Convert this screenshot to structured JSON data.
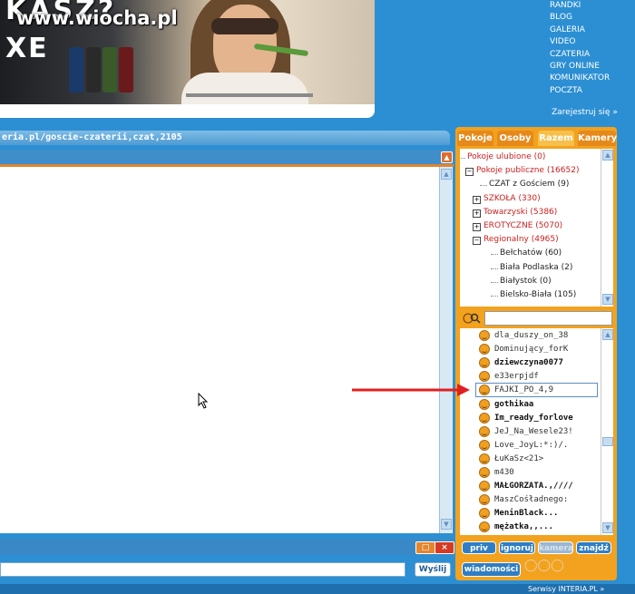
{
  "banner": {
    "headline": "KASZ?",
    "brand": "XE",
    "watermark": "www.wiocha.pl"
  },
  "menu": {
    "items": [
      "RANDKI",
      "BLOG",
      "GALERIA",
      "VIDEO",
      "CZATERIA",
      "GRY ONLINE",
      "KOMUNIKATOR",
      "POCZTA"
    ],
    "register": "Zarejestruj się »"
  },
  "chat": {
    "url": "eria.pl/goscie-czaterii,czat,2105",
    "send_label": "Wyślij",
    "close_glyph": "×",
    "restore_glyph": "□"
  },
  "panel": {
    "tabs": [
      "Pokoje",
      "Osoby",
      "Razem",
      "Kamery"
    ],
    "active_tab": "Razem",
    "tree": [
      {
        "label": "Pokoje ulubione (0)",
        "color": "red",
        "indent": 0,
        "box": ""
      },
      {
        "label": "Pokoje publiczne (16652)",
        "color": "red",
        "indent": 0,
        "box": "−"
      },
      {
        "label": "CZAT z Gościem (9)",
        "color": "black",
        "indent": 2,
        "box": ""
      },
      {
        "label": "SZKOŁA (330)",
        "color": "red",
        "indent": 1,
        "box": "+"
      },
      {
        "label": "Towarzyski (5386)",
        "color": "red",
        "indent": 1,
        "box": "+"
      },
      {
        "label": "EROTYCZNE (5070)",
        "color": "red",
        "indent": 1,
        "box": "+"
      },
      {
        "label": "Regionalny (4965)",
        "color": "red",
        "indent": 1,
        "box": "−"
      },
      {
        "label": "Bełchatów (60)",
        "color": "black",
        "indent": 3,
        "box": ""
      },
      {
        "label": "Biała Podlaska (2)",
        "color": "black",
        "indent": 3,
        "box": ""
      },
      {
        "label": "Białystok (0)",
        "color": "black",
        "indent": 3,
        "box": ""
      },
      {
        "label": "Bielsko-Biała (105)",
        "color": "black",
        "indent": 3,
        "box": ""
      }
    ],
    "users": [
      {
        "name": "dla_duszy_on_38",
        "bold": false
      },
      {
        "name": "Dominujący_forK",
        "bold": false
      },
      {
        "name": "dziewczyna0077",
        "bold": true
      },
      {
        "name": "e33erpjdf",
        "bold": false
      },
      {
        "name": "FAJKI_PO_4,9",
        "bold": false
      },
      {
        "name": "gothikaa",
        "bold": true
      },
      {
        "name": "Im_ready_forlove",
        "bold": true
      },
      {
        "name": "JeJ_Na_Wesele23!",
        "bold": false
      },
      {
        "name": "Love_JoyL:*:)/.",
        "bold": false
      },
      {
        "name": "ŁuKaSz<21>",
        "bold": false
      },
      {
        "name": "m430",
        "bold": false
      },
      {
        "name": "MAŁGORZATA.,////",
        "bold": true
      },
      {
        "name": "MaszCośładnego:",
        "bold": false
      },
      {
        "name": "MeninBlack...",
        "bold": true
      },
      {
        "name": "mężatka,,...",
        "bold": true
      }
    ],
    "highlighted_user": "FAJKI_PO_4,9",
    "actions": [
      "priv",
      "ignoruj",
      "kamera",
      "znajdź"
    ],
    "messages_btn": "wiadomości"
  },
  "footer": {
    "text": "Serwisy INTERIA.PL »"
  },
  "colors": {
    "accent_orange": "#f2a21e",
    "bg_blue": "#2c8fd3",
    "arrow_red": "#e02020"
  }
}
